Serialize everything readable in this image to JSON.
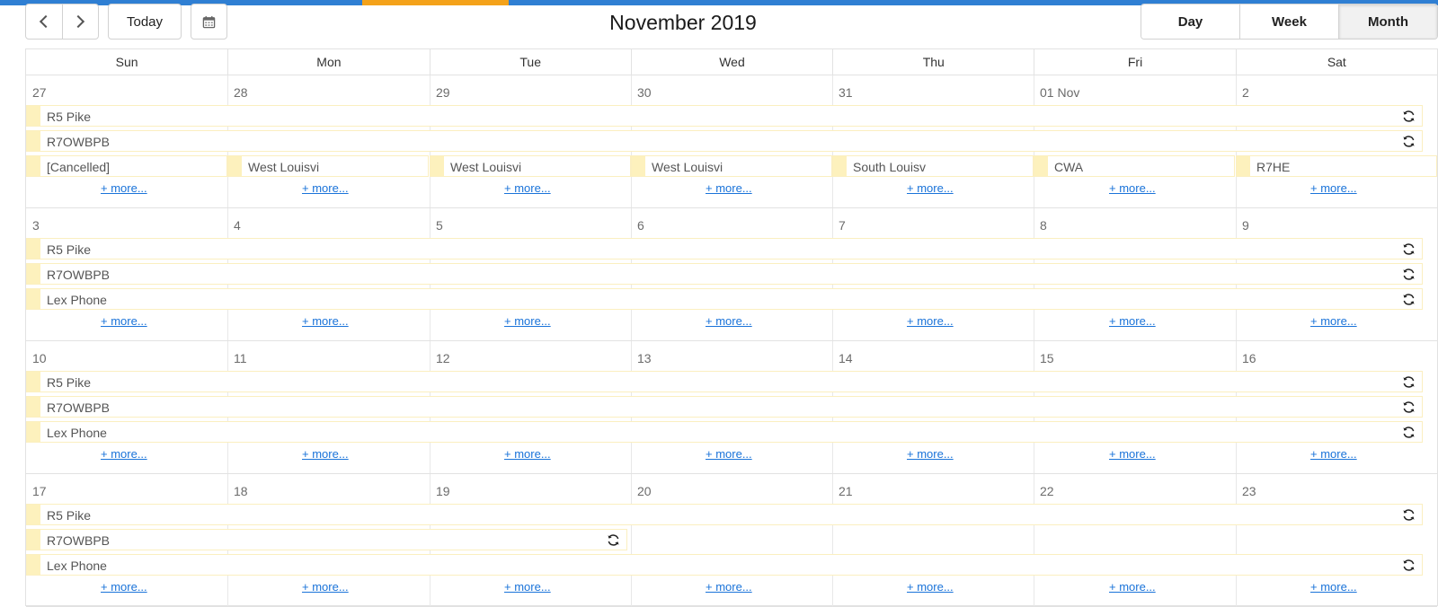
{
  "toolbar": {
    "today_label": "Today",
    "title": "November 2019",
    "views": [
      {
        "label": "Day",
        "active": false
      },
      {
        "label": "Week",
        "active": false
      },
      {
        "label": "Month",
        "active": true
      }
    ]
  },
  "days_of_week": [
    "Sun",
    "Mon",
    "Tue",
    "Wed",
    "Thu",
    "Fri",
    "Sat"
  ],
  "more_label": "+ more...",
  "colors": {
    "accent": "#2f7fd3",
    "highlight": "#f4a21a",
    "event_stripe": "#fdf1bd",
    "link": "#1a73d9"
  },
  "weeks": [
    {
      "days": [
        "27",
        "28",
        "29",
        "30",
        "31",
        "01 Nov",
        "2"
      ],
      "events": [
        {
          "label": "R5 Pike",
          "start": 0,
          "span": 7,
          "row": 0,
          "recurring": true
        },
        {
          "label": "R7OWBPB",
          "start": 0,
          "span": 7,
          "row": 1,
          "recurring": true
        },
        {
          "label": "[Cancelled]",
          "start": 0,
          "span": 1,
          "row": 2,
          "recurring": false
        },
        {
          "label": "West Louisvi",
          "start": 1,
          "span": 1,
          "row": 2,
          "recurring": false
        },
        {
          "label": "West Louisvi",
          "start": 2,
          "span": 1,
          "row": 2,
          "recurring": false
        },
        {
          "label": "West Louisvi",
          "start": 3,
          "span": 1,
          "row": 2,
          "recurring": false
        },
        {
          "label": "South Louisv",
          "start": 4,
          "span": 1,
          "row": 2,
          "recurring": false
        },
        {
          "label": "CWA",
          "start": 5,
          "span": 1,
          "row": 2,
          "recurring": false
        },
        {
          "label": "R7HE",
          "start": 6,
          "span": 1,
          "row": 2,
          "recurring": false
        }
      ]
    },
    {
      "days": [
        "3",
        "4",
        "5",
        "6",
        "7",
        "8",
        "9"
      ],
      "events": [
        {
          "label": "R5 Pike",
          "start": 0,
          "span": 7,
          "row": 0,
          "recurring": true
        },
        {
          "label": "R7OWBPB",
          "start": 0,
          "span": 7,
          "row": 1,
          "recurring": true
        },
        {
          "label": "Lex Phone",
          "start": 0,
          "span": 7,
          "row": 2,
          "recurring": true
        }
      ]
    },
    {
      "days": [
        "10",
        "11",
        "12",
        "13",
        "14",
        "15",
        "16"
      ],
      "events": [
        {
          "label": "R5 Pike",
          "start": 0,
          "span": 7,
          "row": 0,
          "recurring": true
        },
        {
          "label": "R7OWBPB",
          "start": 0,
          "span": 7,
          "row": 1,
          "recurring": true
        },
        {
          "label": "Lex Phone",
          "start": 0,
          "span": 7,
          "row": 2,
          "recurring": true
        }
      ]
    },
    {
      "days": [
        "17",
        "18",
        "19",
        "20",
        "21",
        "22",
        "23"
      ],
      "events": [
        {
          "label": "R5 Pike",
          "start": 0,
          "span": 7,
          "row": 0,
          "recurring": true
        },
        {
          "label": "R7OWBPB",
          "start": 0,
          "span": 3,
          "row": 1,
          "recurring": true
        },
        {
          "label": "Lex Phone",
          "start": 0,
          "span": 7,
          "row": 2,
          "recurring": true
        }
      ]
    }
  ]
}
